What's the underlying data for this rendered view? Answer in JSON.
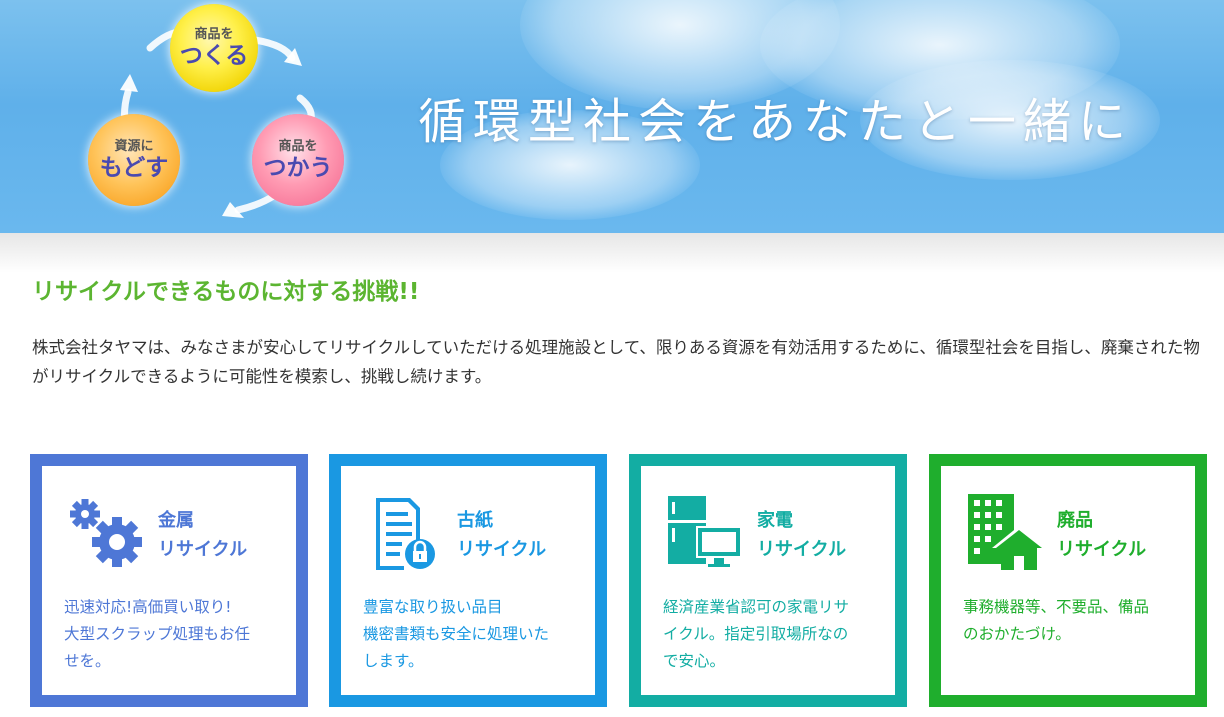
{
  "hero": {
    "title": "循環型社会をあなたと一緒に",
    "cycle": {
      "make_small": "商品を",
      "make_big": "つくる",
      "use_small": "商品を",
      "use_big": "つかう",
      "return_small": "資源に",
      "return_big": "もどす"
    }
  },
  "intro": {
    "heading": "リサイクルできるものに対する挑戦!!",
    "body": "株式会社タヤマは、みなさまが安心してリサイクルしていただける処理施設として、限りある資源を有効活用するために、循環型社会を目指し、廃棄された物がリサイクルできるように可能性を模索し、挑戦し続けます。"
  },
  "cards": [
    {
      "title_line1": "金属",
      "title_line2": "リサイクル",
      "desc_line1": "迅速対応!高価買い取り!",
      "desc_line2": "大型スクラップ処理もお任",
      "desc_line3": "せを。",
      "icon": "gears-icon",
      "color": "#4e77d6"
    },
    {
      "title_line1": "古紙",
      "title_line2": "リサイクル",
      "desc_line1": "豊富な取り扱い品目",
      "desc_line2": "機密書類も安全に処理いた",
      "desc_line3": "します。",
      "icon": "document-lock-icon",
      "color": "#1a98e2"
    },
    {
      "title_line1": "家電",
      "title_line2": "リサイクル",
      "desc_line1": "経済産業省認可の家電リサ",
      "desc_line2": "イクル。指定引取場所なの",
      "desc_line3": "で安心。",
      "icon": "appliances-icon",
      "color": "#13ada3"
    },
    {
      "title_line1": "廃品",
      "title_line2": "リサイクル",
      "desc_line1": "事務機器等、不要品、備品",
      "desc_line2": "のおかたづけ。",
      "desc_line3": "",
      "icon": "building-house-icon",
      "color": "#1fae2d"
    }
  ]
}
